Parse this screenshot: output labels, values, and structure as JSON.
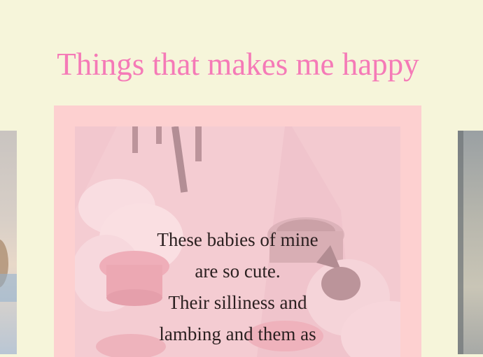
{
  "page": {
    "title": "Things that makes me happy"
  },
  "card": {
    "image_subject": "cats-eating-photo",
    "text_lines": [
      "These babies of mine",
      "are so cute.",
      "Their silliness and",
      "lambing and them as"
    ]
  },
  "colors": {
    "background": "#f6f5da",
    "title": "#f57ab7",
    "card_frame": "#fdd0d0",
    "text": "#2b2020"
  }
}
